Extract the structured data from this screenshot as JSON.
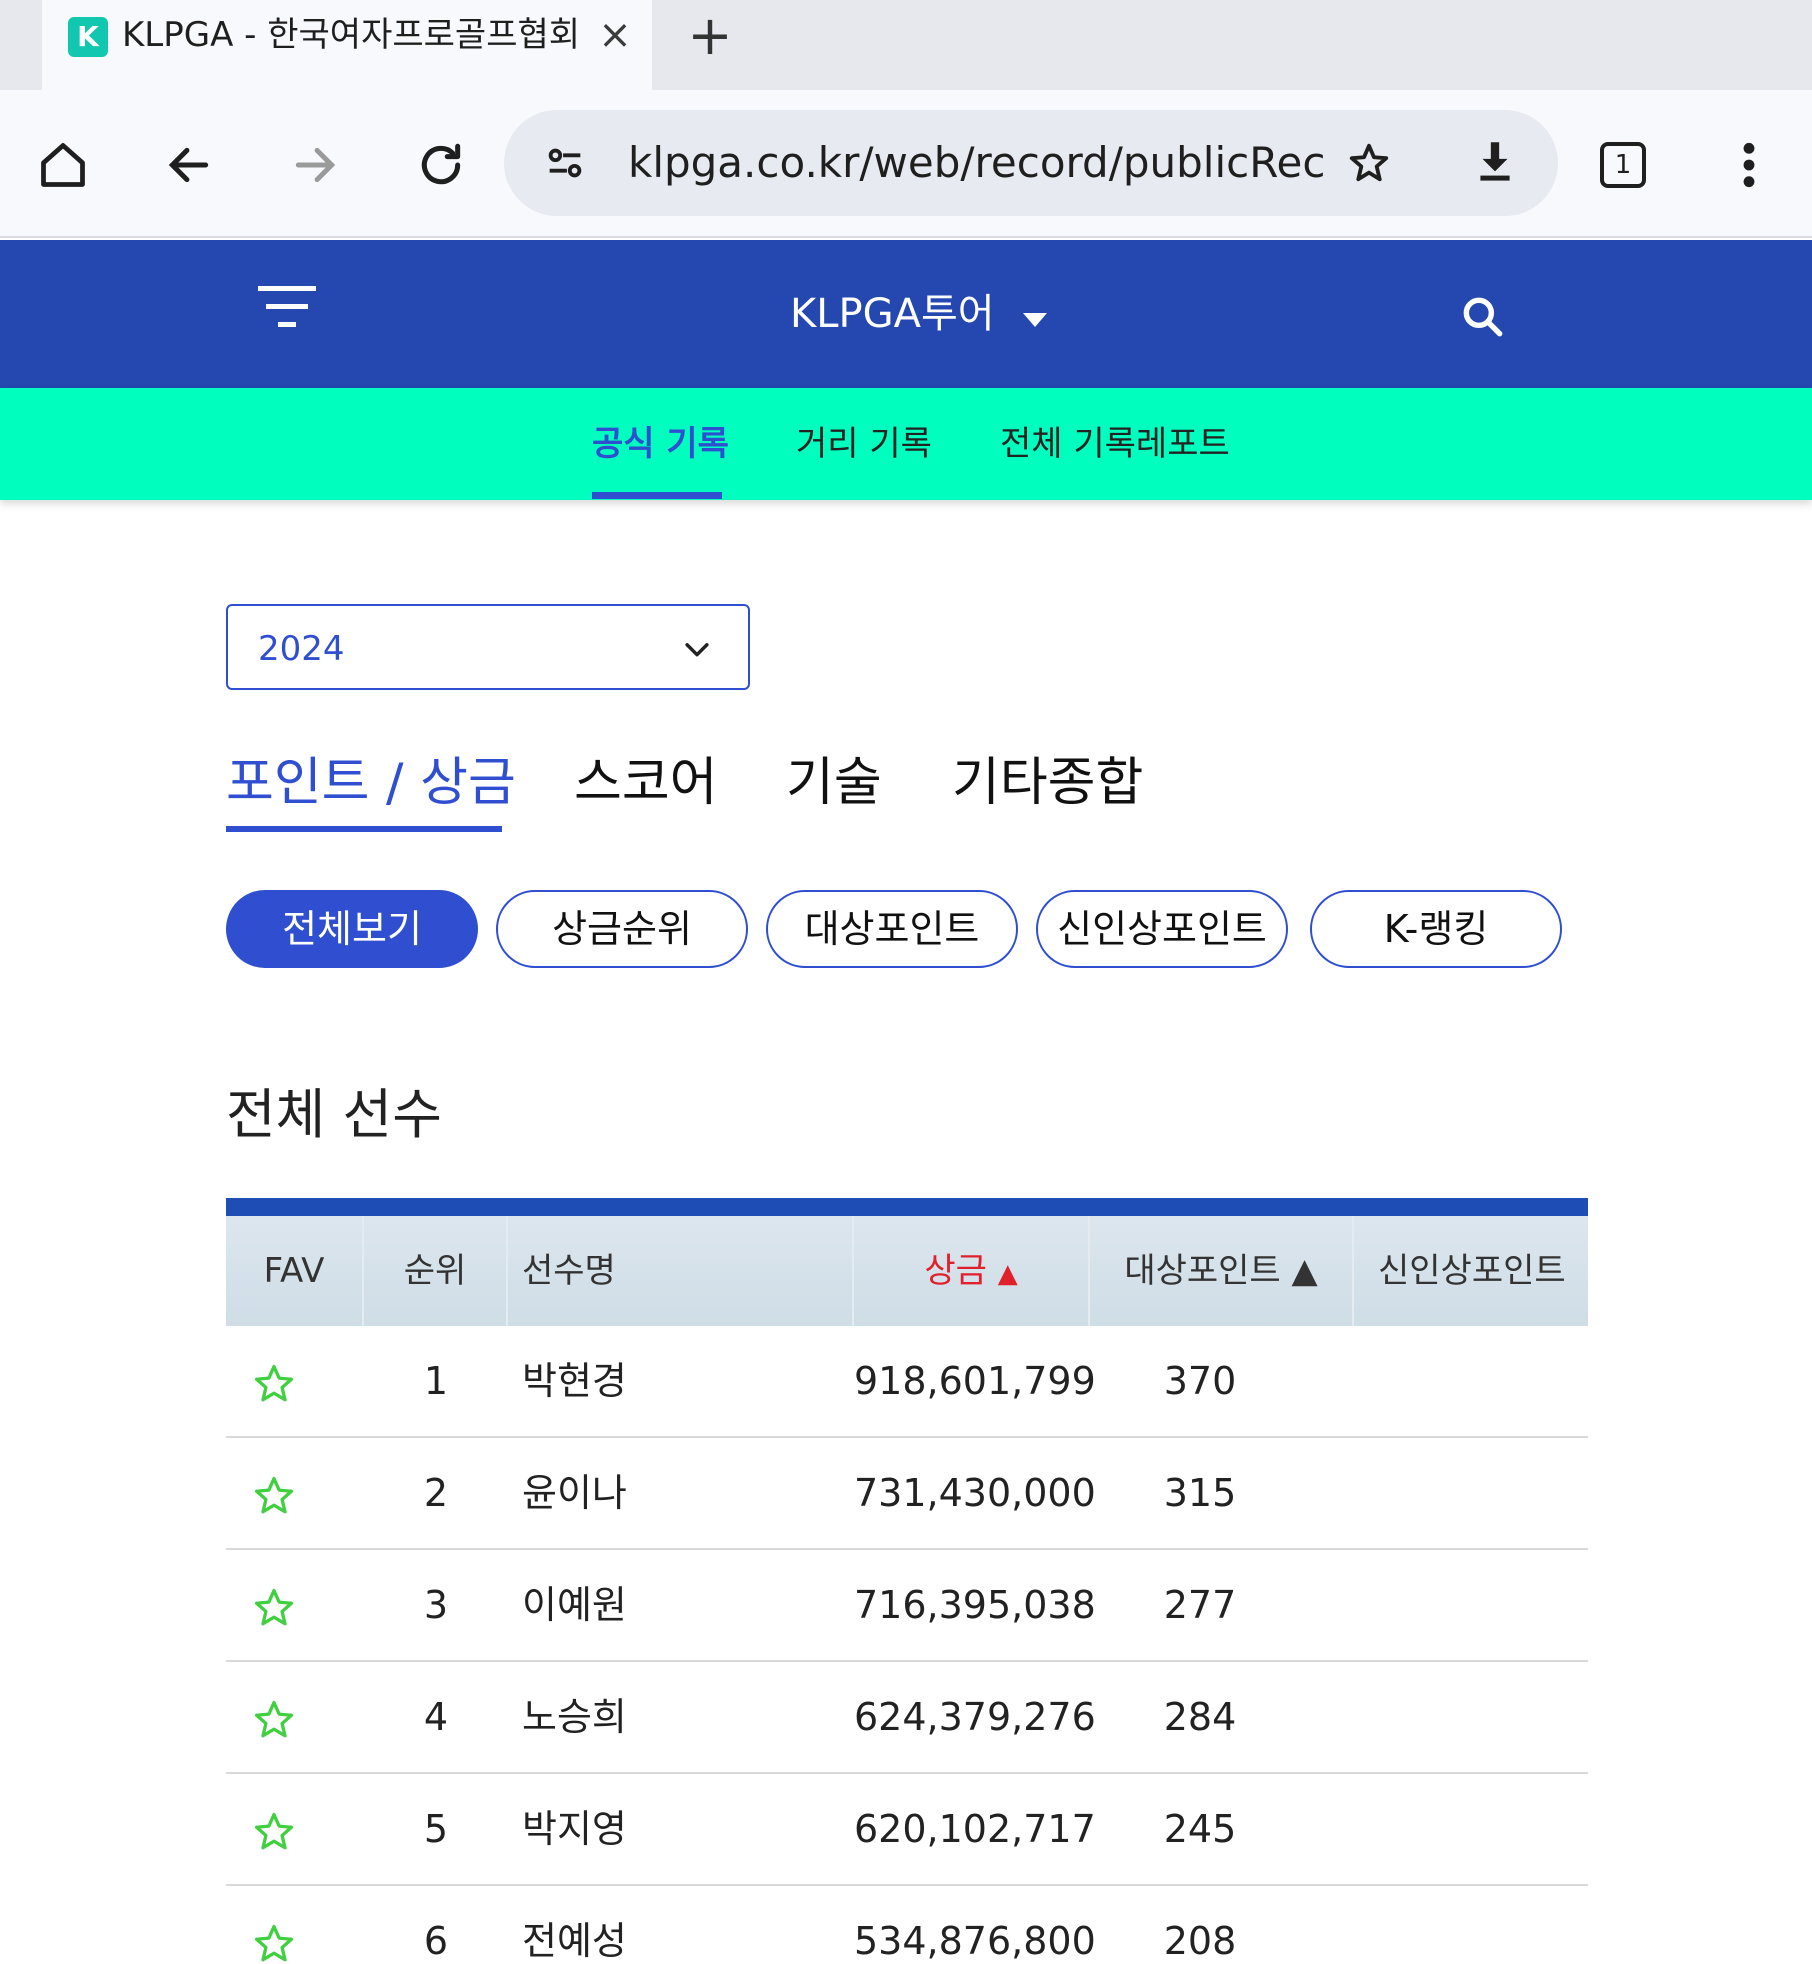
{
  "browser": {
    "tab_title": "KLPGA - 한국여자프로골프협회",
    "favicon_letter": "K",
    "url": "klpga.co.kr/web/record/publicRec",
    "tab_count": "1"
  },
  "site": {
    "brand": "KLPGA투어",
    "subnav": [
      "공식 기록",
      "거리 기록",
      "전체 기록레포트"
    ],
    "active_subnav": "공식 기록"
  },
  "filters": {
    "year": "2024",
    "categories": [
      "포인트 / 상금",
      "스코어",
      "기술",
      "기타종합"
    ],
    "pills": [
      "전체보기",
      "상금순위",
      "대상포인트",
      "신인상포인트",
      "K-랭킹"
    ]
  },
  "section_title": "전체 선수",
  "table": {
    "headers": [
      "FAV",
      "순위",
      "선수명",
      "상금",
      "▲",
      "대상포인트 ▲",
      "신인상포인트"
    ],
    "rows": [
      {
        "rank": "1",
        "name": "박현경",
        "prize": "918,601,799",
        "points": "370"
      },
      {
        "rank": "2",
        "name": "윤이나",
        "prize": "731,430,000",
        "points": "315"
      },
      {
        "rank": "3",
        "name": "이예원",
        "prize": "716,395,038",
        "points": "277"
      },
      {
        "rank": "4",
        "name": "노승희",
        "prize": "624,379,276",
        "points": "284"
      },
      {
        "rank": "5",
        "name": "박지영",
        "prize": "620,102,717",
        "points": "245"
      },
      {
        "rank": "6",
        "name": "전예성",
        "prize": "534,876,800",
        "points": "208"
      }
    ]
  },
  "colors": {
    "header_blue": "#2548b0",
    "subnav_mint": "#00ffbf",
    "accent": "#2f4fd0",
    "sort_red": "#e0212b",
    "star_green": "#3fcf3f"
  }
}
